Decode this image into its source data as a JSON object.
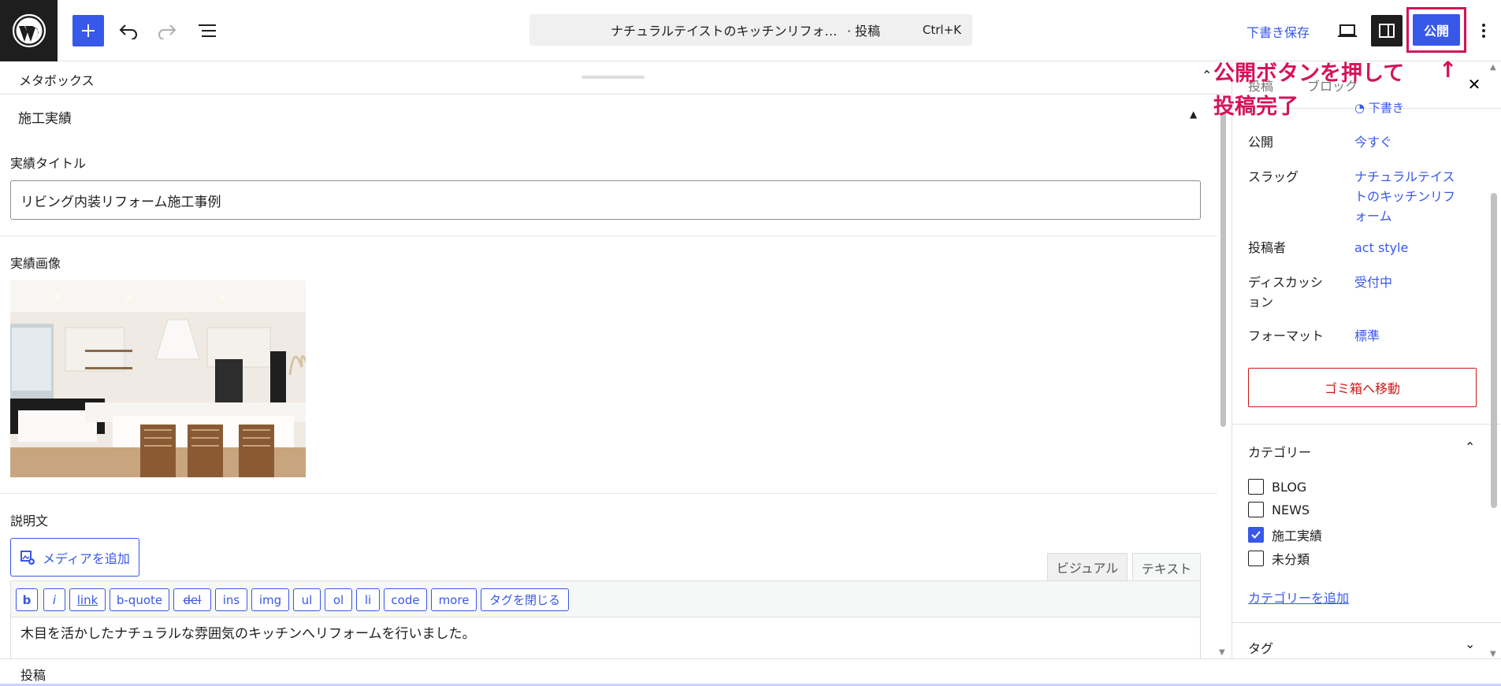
{
  "toolbar": {
    "command_title": "ナチュラルテイストのキッチンリフォ…",
    "command_kind": "· 投稿",
    "shortcut": "Ctrl+K",
    "save_draft": "下書き保存",
    "publish": "公開"
  },
  "annotation": {
    "line1": "公開ボタンを押して",
    "line2": "投稿完了",
    "arrow": "↑"
  },
  "metabox": {
    "label": "メタボックス",
    "section_title": "施工実績",
    "title_label": "実績タイトル",
    "title_value": "リビング内装リフォーム施工事例",
    "image_label": "実績画像",
    "image_alt": "kitchen-photo",
    "description_label": "説明文",
    "add_media": "メディアを追加",
    "tab_visual": "ビジュアル",
    "tab_text": "テキスト",
    "quicktags": [
      "b",
      "i",
      "link",
      "b-quote",
      "del",
      "ins",
      "img",
      "ul",
      "ol",
      "li",
      "code",
      "more",
      "タグを閉じる"
    ],
    "content": "木目を活かしたナチュラルな雰囲気のキッチンへリフォームを行いました。"
  },
  "footer": {
    "breadcrumb": "投稿"
  },
  "sidebar": {
    "tab_post": "投稿",
    "tab_block": "ブロック",
    "status_value": "下書き",
    "rows": [
      {
        "label": "公開",
        "value": "今すぐ"
      },
      {
        "label": "スラッグ",
        "value": "ナチュラルテイストのキッチンリフォーム"
      },
      {
        "label": "投稿者",
        "value": "act style"
      },
      {
        "label": "ディスカッション",
        "value": "受付中"
      },
      {
        "label": "フォーマット",
        "value": "標準"
      }
    ],
    "trash": "ゴミ箱へ移動",
    "categories_title": "カテゴリー",
    "categories": [
      {
        "name": "BLOG",
        "checked": false
      },
      {
        "name": "NEWS",
        "checked": false
      },
      {
        "name": "施工実績",
        "checked": true
      },
      {
        "name": "未分類",
        "checked": false
      }
    ],
    "add_category": "カテゴリーを追加",
    "tags_title": "タグ"
  },
  "colors": {
    "accent": "#3858e9",
    "annotation": "#d4145a",
    "danger": "#cc1818"
  }
}
